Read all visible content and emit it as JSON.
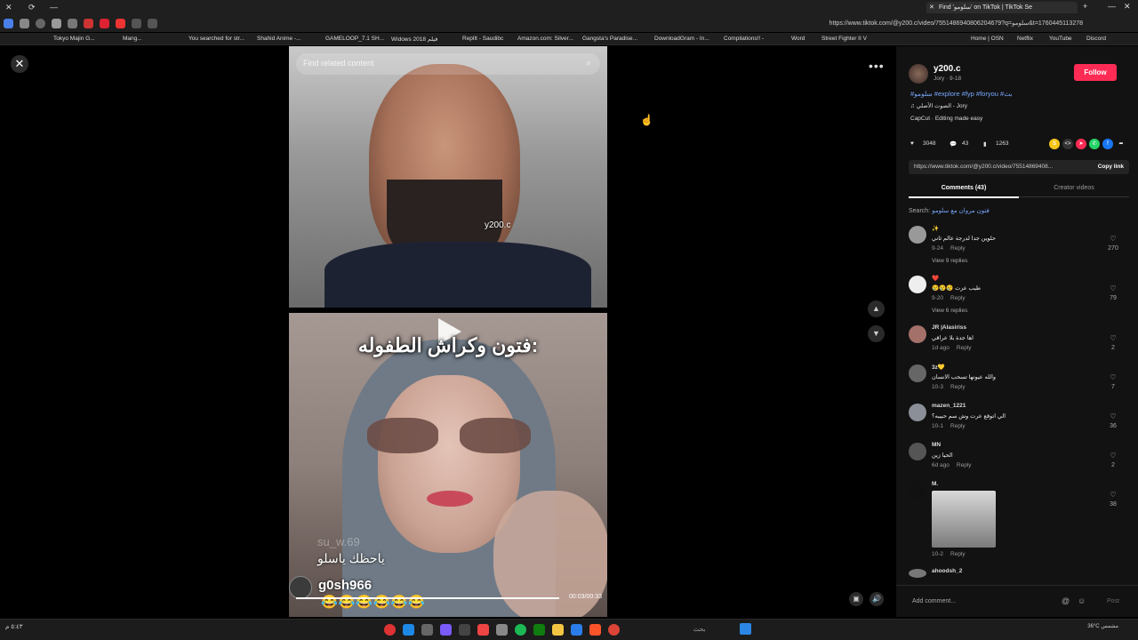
{
  "browser": {
    "active_tab_title": "Find 'سلومو' on TikTok | TikTok Se",
    "url": "https://www.tiktok.com/@y200.c/video/7551486940806204679?q=سلومو&t=1760445113278",
    "bookmarks": [
      "Tokyo Majin G...",
      "Mang...",
      "You searched for str...",
      "Shahid Anime -...",
      "GAMELOOP_7.1 SH...",
      "Widows 2018 فيلم",
      "ReplIt - Saudibc",
      "Amazon.com: Silver...",
      "Gangsta's Paradise...",
      "DownloadGram - In...",
      "Compilations!! -",
      "Word",
      "Street Fighter II V",
      "Home | OSN",
      "Netflix",
      "YouTube",
      "Discord"
    ]
  },
  "video": {
    "search_placeholder": "Find related content",
    "watermark": "y200.c",
    "caption": "فتون وكراش الطفوله:",
    "ghost_name": "su_w.69",
    "overlay_text": "ياحظك ياسلو",
    "live_name": "g0sh966",
    "emojis": "😂😂😂😂😂😂",
    "progress": 1.0,
    "time": "00:03/00:33"
  },
  "author": {
    "name": "y200.c",
    "sub": "Jory · 9-18",
    "follow_label": "Follow",
    "hashtags": "#سلومو #explore #fyp #foryou #بث",
    "music": "♫ الصوت الأصلي - Jory",
    "capcut": "CapCut · Editing made easy"
  },
  "stats": {
    "likes": "3048",
    "comments": "43",
    "saves": "1263"
  },
  "link": {
    "url": "https://www.tiktok.com/@y200.c/video/75514869408...",
    "copy_label": "Copy link"
  },
  "tabs": {
    "comments": "Comments (43)",
    "creator": "Creator videos"
  },
  "search": {
    "label": "Search:",
    "query": "فتون مروان مع سلومو"
  },
  "comments": [
    {
      "user": "✨",
      "text": "حلوين جدا لدرجة عالم ثاني",
      "date": "9-24",
      "reply": "Reply",
      "replies": "View 9 replies",
      "likes": "270"
    },
    {
      "user": "❤️",
      "text": "😢😢😢 طيب عرت",
      "date": "9-20",
      "reply": "Reply",
      "replies": "View 6 replies",
      "likes": "79"
    },
    {
      "user": "JR |Alasiriss",
      "text": "اها جدة بلا عراقي",
      "date": "1d ago",
      "reply": "Reply",
      "replies": "",
      "likes": "2"
    },
    {
      "user": "3z💛",
      "text": "والله عيونها تسحب الانسان",
      "date": "10-3",
      "reply": "Reply",
      "replies": "",
      "likes": "7"
    },
    {
      "user": "mazen_1221",
      "text": "الي اتوقع عرت وش سم حبيبه؟",
      "date": "10-1",
      "reply": "Reply",
      "replies": "",
      "likes": "36"
    },
    {
      "user": "MN",
      "text": "الحيا زين",
      "date": "6d ago",
      "reply": "Reply",
      "replies": "",
      "likes": "2"
    },
    {
      "user": "M.",
      "text": "",
      "date": "10-2",
      "reply": "Reply",
      "replies": "",
      "likes": "38"
    }
  ],
  "cut_off_user": "ahoodsh_2",
  "add_comment": {
    "placeholder": "Add comment...",
    "post_label": "Post"
  },
  "taskbar": {
    "search": "بحث",
    "weather": "36°C مشمس",
    "clock": "٥:٤٣ م"
  },
  "colors": {
    "accent": "#fe2c55",
    "hashtag": "#7aa7ff"
  }
}
